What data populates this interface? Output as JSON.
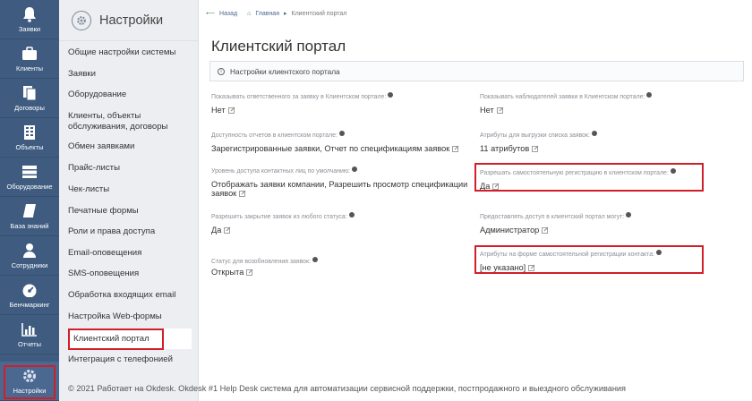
{
  "rail": [
    {
      "label": "Заявки",
      "icon": "bell-icon"
    },
    {
      "label": "Клиенты",
      "icon": "briefcase-icon"
    },
    {
      "label": "Договоры",
      "icon": "documents-icon"
    },
    {
      "label": "Объекты",
      "icon": "building-icon"
    },
    {
      "label": "Оборудование",
      "icon": "server-icon"
    },
    {
      "label": "База знаний",
      "icon": "book-icon"
    },
    {
      "label": "Сотрудники",
      "icon": "person-icon"
    },
    {
      "label": "Бенчмаркинг",
      "icon": "gauge-icon"
    },
    {
      "label": "Отчеты",
      "icon": "chart-icon"
    },
    {
      "label": "Настройки",
      "icon": "gear-icon"
    }
  ],
  "menu": {
    "title": "Настройки",
    "items": [
      "Общие настройки системы",
      "Заявки",
      "Оборудование",
      "Клиенты, объекты обслуживания, договоры",
      "Обмен заявками",
      "Прайс-листы",
      "Чек-листы",
      "Печатные формы",
      "Роли и права доступа",
      "Email-оповещения",
      "SMS-оповещения",
      "Обработка входящих email",
      "Настройка Web-формы",
      "Клиентский портал",
      "Интеграция с телефонией"
    ]
  },
  "breadcrumb": {
    "back": "Назад",
    "home": "Главная",
    "current": "Клиентский портал"
  },
  "page": {
    "title": "Клиентский портал",
    "section": "Настройки клиентского портала"
  },
  "fields": {
    "show_responsible": {
      "label": "Показывать ответственного за заявку в Клиентском портале:",
      "value": "Нет"
    },
    "show_observers": {
      "label": "Показывать наблюдателей заявки в Клиентском портале:",
      "value": "Нет"
    },
    "reports_available": {
      "label": "Доступность отчетов в клиентском портале:",
      "value": "Зарегистрированные заявки, Отчет по спецификациям заявок"
    },
    "export_attributes": {
      "label": "Атрибуты для выгрузки списка заявок:",
      "value": "11 атрибутов"
    },
    "access_level": {
      "label": "Уровень доступа контактных лиц по умолчанию:",
      "value": "Отображать заявки компании, Разрешить просмотр спецификации заявок"
    },
    "self_registration": {
      "label": "Разрешать самостоятельную регистрацию в клиентском портале:",
      "value": "Да"
    },
    "close_any_status": {
      "label": "Разрешить закрытие заявок из любого статуса:",
      "value": "Да"
    },
    "portal_access_by": {
      "label": "Предоставлять доступ в клиентский портал могут:",
      "value": "Администратор"
    },
    "reopen_status": {
      "label": "Статус для возобновления заявок:",
      "value": "Открыта"
    },
    "registration_attributes": {
      "label": "Атрибуты на форме самостоятельной регистрации контакта:",
      "value": "[не указано]"
    }
  },
  "footer": "© 2021 Работает на Okdesk. Okdesk #1 Help Desk система для автоматизации сервисной поддержки, постпродажного и выездного обслуживания",
  "colors": {
    "rail": "#3f5c80",
    "highlight": "#d11f2a",
    "link": "#4a6890"
  }
}
